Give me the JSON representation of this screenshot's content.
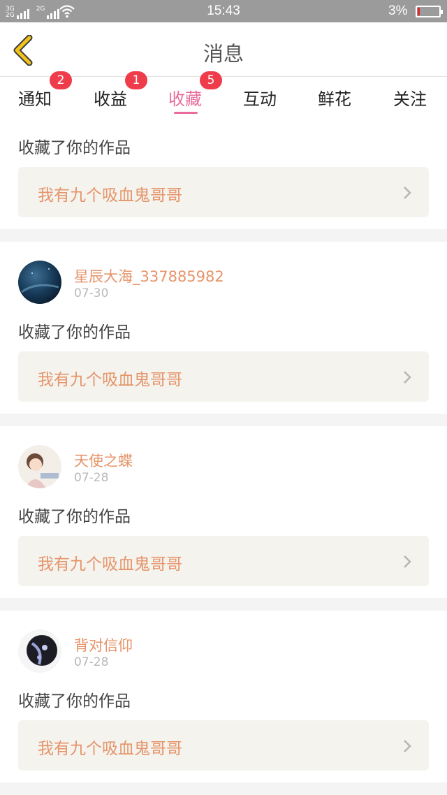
{
  "status_bar": {
    "net1_top": "3G",
    "net1_bottom": "2G",
    "net2": "2G",
    "time": "15:43",
    "battery_pct": "3%",
    "battery_level": 0.03
  },
  "header": {
    "title": "消息",
    "back_icon": "chevron-left-icon",
    "accent_color": "#f2c21b"
  },
  "tabs": [
    {
      "label": "通知",
      "badge": "2"
    },
    {
      "label": "收益",
      "badge": "1"
    },
    {
      "label": "收藏",
      "badge": "5",
      "active": true
    },
    {
      "label": "互动"
    },
    {
      "label": "鲜花"
    },
    {
      "label": "关注"
    }
  ],
  "feed": [
    {
      "action": "收藏了你的作品",
      "work_title": "我有九个吸血鬼哥哥"
    },
    {
      "user": "星辰大海_337885982",
      "date": "07-30",
      "action": "收藏了你的作品",
      "work_title": "我有九个吸血鬼哥哥"
    },
    {
      "user": "天使之蝶",
      "date": "07-28",
      "action": "收藏了你的作品",
      "work_title": "我有九个吸血鬼哥哥"
    },
    {
      "user": "背对信仰",
      "date": "07-28",
      "action": "收藏了你的作品",
      "work_title": "我有九个吸血鬼哥哥"
    }
  ],
  "colors": {
    "active_tab": "#e86d9c",
    "badge": "#ef3c4b",
    "link": "#e6946a",
    "card_bg": "#f4f3ee"
  }
}
